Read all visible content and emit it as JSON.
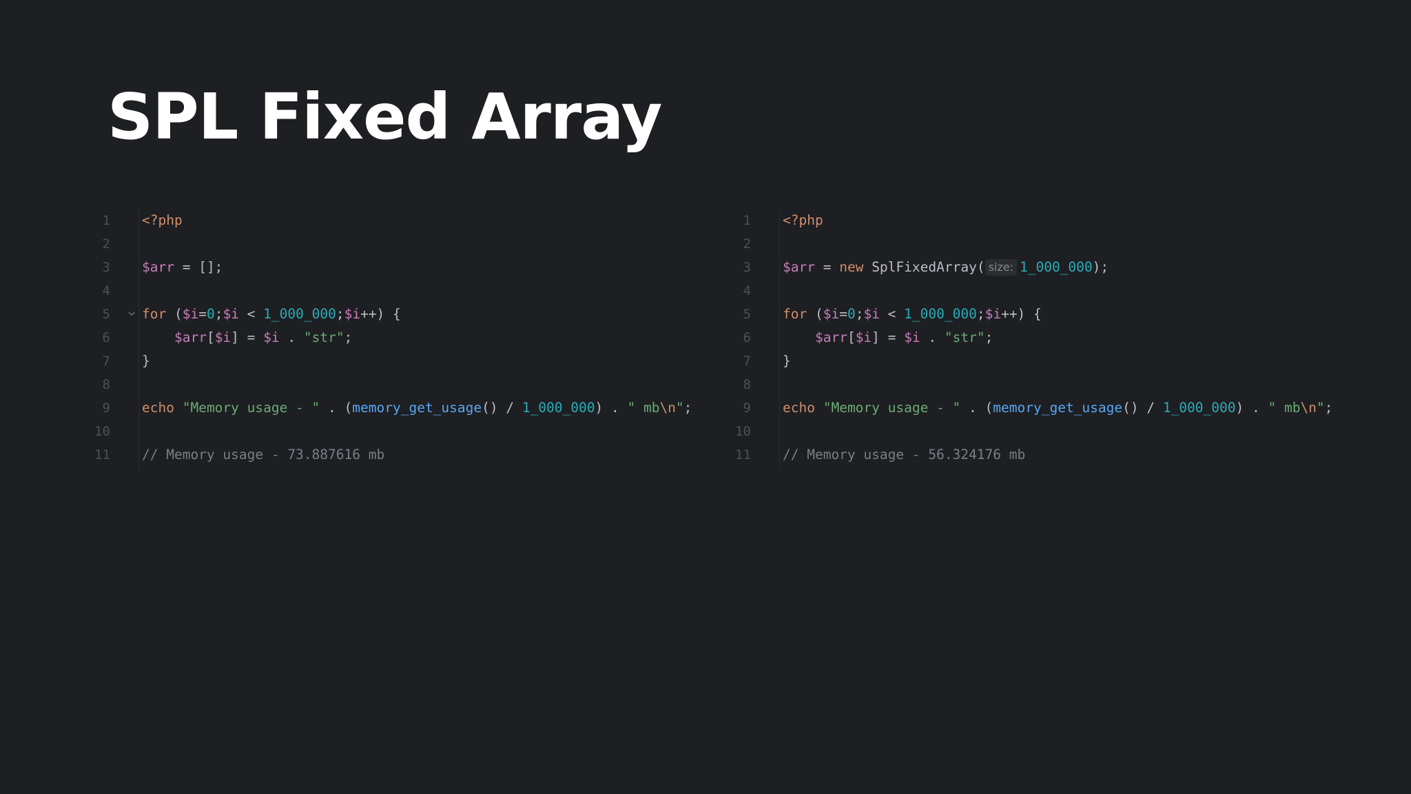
{
  "slide": {
    "title": "SPL Fixed Array"
  },
  "editors": {
    "left": {
      "line_numbers": [
        "1",
        "2",
        "3",
        "4",
        "5",
        "6",
        "7",
        "8",
        "9",
        "10",
        "11"
      ],
      "lines": {
        "l1": {
          "tag": "<?php"
        },
        "l3": {
          "var": "$arr",
          "eq": " = ",
          "rest": "[];"
        },
        "l5": {
          "kw": "for",
          "p1": " (",
          "v1": "$i",
          "e1": "=",
          "n1": "0",
          "s1": ";",
          "v2": "$i",
          "lt": " < ",
          "n2": "1_000_000",
          "s2": ";",
          "v3": "$i",
          "tail": "++) {"
        },
        "l6": {
          "indent": "    ",
          "v1": "$arr",
          "b1": "[",
          "v2": "$i",
          "b2": "]",
          "eq": " = ",
          "v3": "$i",
          "dot": " . ",
          "str": "\"str\"",
          "semi": ";"
        },
        "l7": {
          "brace": "}"
        },
        "l9": {
          "kw": "echo",
          "sp": " ",
          "s1": "\"Memory usage - \"",
          "d1": " . (",
          "fn": "memory_get_usage",
          "call": "() / ",
          "num": "1_000_000",
          "d2": ") . ",
          "s2": "\" mb",
          "esc": "\\n",
          "s3": "\"",
          "semi": ";"
        },
        "l11": {
          "comment": "// Memory usage - 73.887616 mb"
        }
      }
    },
    "right": {
      "line_numbers": [
        "1",
        "2",
        "3",
        "4",
        "5",
        "6",
        "7",
        "8",
        "9",
        "10",
        "11"
      ],
      "lines": {
        "l1": {
          "tag": "<?php"
        },
        "l3": {
          "var": "$arr",
          "eq": " = ",
          "kw": "new",
          "sp": " ",
          "cls": "SplFixedArray",
          "paren": "(",
          "hint": "size:",
          "num": "1_000_000",
          "tail": ");"
        },
        "l5": {
          "kw": "for",
          "p1": " (",
          "v1": "$i",
          "e1": "=",
          "n1": "0",
          "s1": ";",
          "v2": "$i",
          "lt": " < ",
          "n2": "1_000_000",
          "s2": ";",
          "v3": "$i",
          "tail": "++) {"
        },
        "l6": {
          "indent": "    ",
          "v1": "$arr",
          "b1": "[",
          "v2": "$i",
          "b2": "]",
          "eq": " = ",
          "v3": "$i",
          "dot": " . ",
          "str": "\"str\"",
          "semi": ";"
        },
        "l7": {
          "brace": "}"
        },
        "l9": {
          "kw": "echo",
          "sp": " ",
          "s1": "\"Memory usage - \"",
          "d1": " . (",
          "fn": "memory_get_usage",
          "call": "() / ",
          "num": "1_000_000",
          "d2": ") . ",
          "s2": "\" mb",
          "esc": "\\n",
          "s3": "\"",
          "semi": ";"
        },
        "l11": {
          "comment": "// Memory usage - 56.324176 mb"
        }
      }
    }
  },
  "icons": {
    "fold": "chevron-down-icon"
  },
  "colors": {
    "background": "#1e1f22",
    "keyword": "#cf8e6d",
    "variable": "#c77dbb",
    "number": "#2aacb8",
    "string": "#6aab73",
    "function": "#56a8f5",
    "comment": "#7a7e85"
  }
}
